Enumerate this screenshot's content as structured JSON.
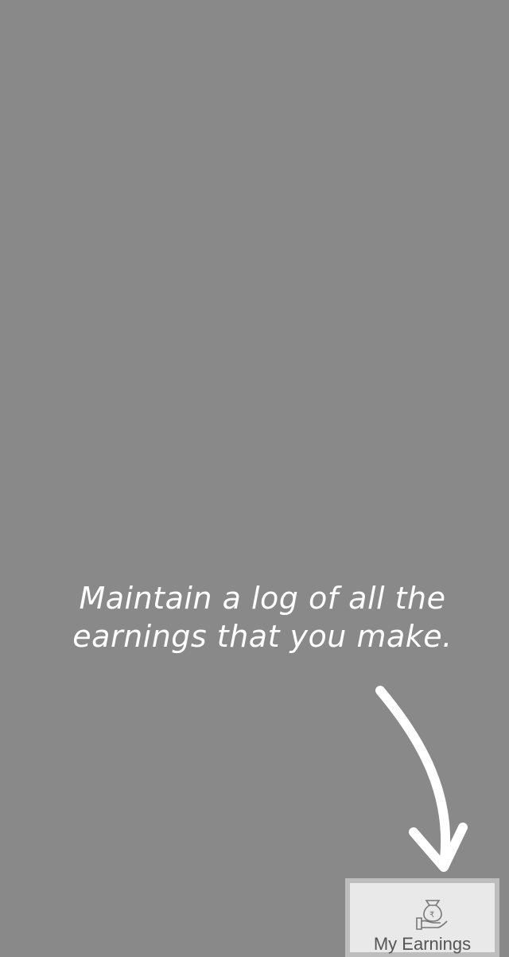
{
  "coachmark": {
    "message": "Maintain a log of all the earnings that you make."
  },
  "bottom_nav": {
    "my_earnings": {
      "label": "My Earnings",
      "icon": "money-bag-hand-icon"
    }
  },
  "colors": {
    "overlay": "#898989",
    "text": "#ffffff",
    "highlight_border": "#bdbdbd",
    "nav_background": "#e9e9e9"
  }
}
